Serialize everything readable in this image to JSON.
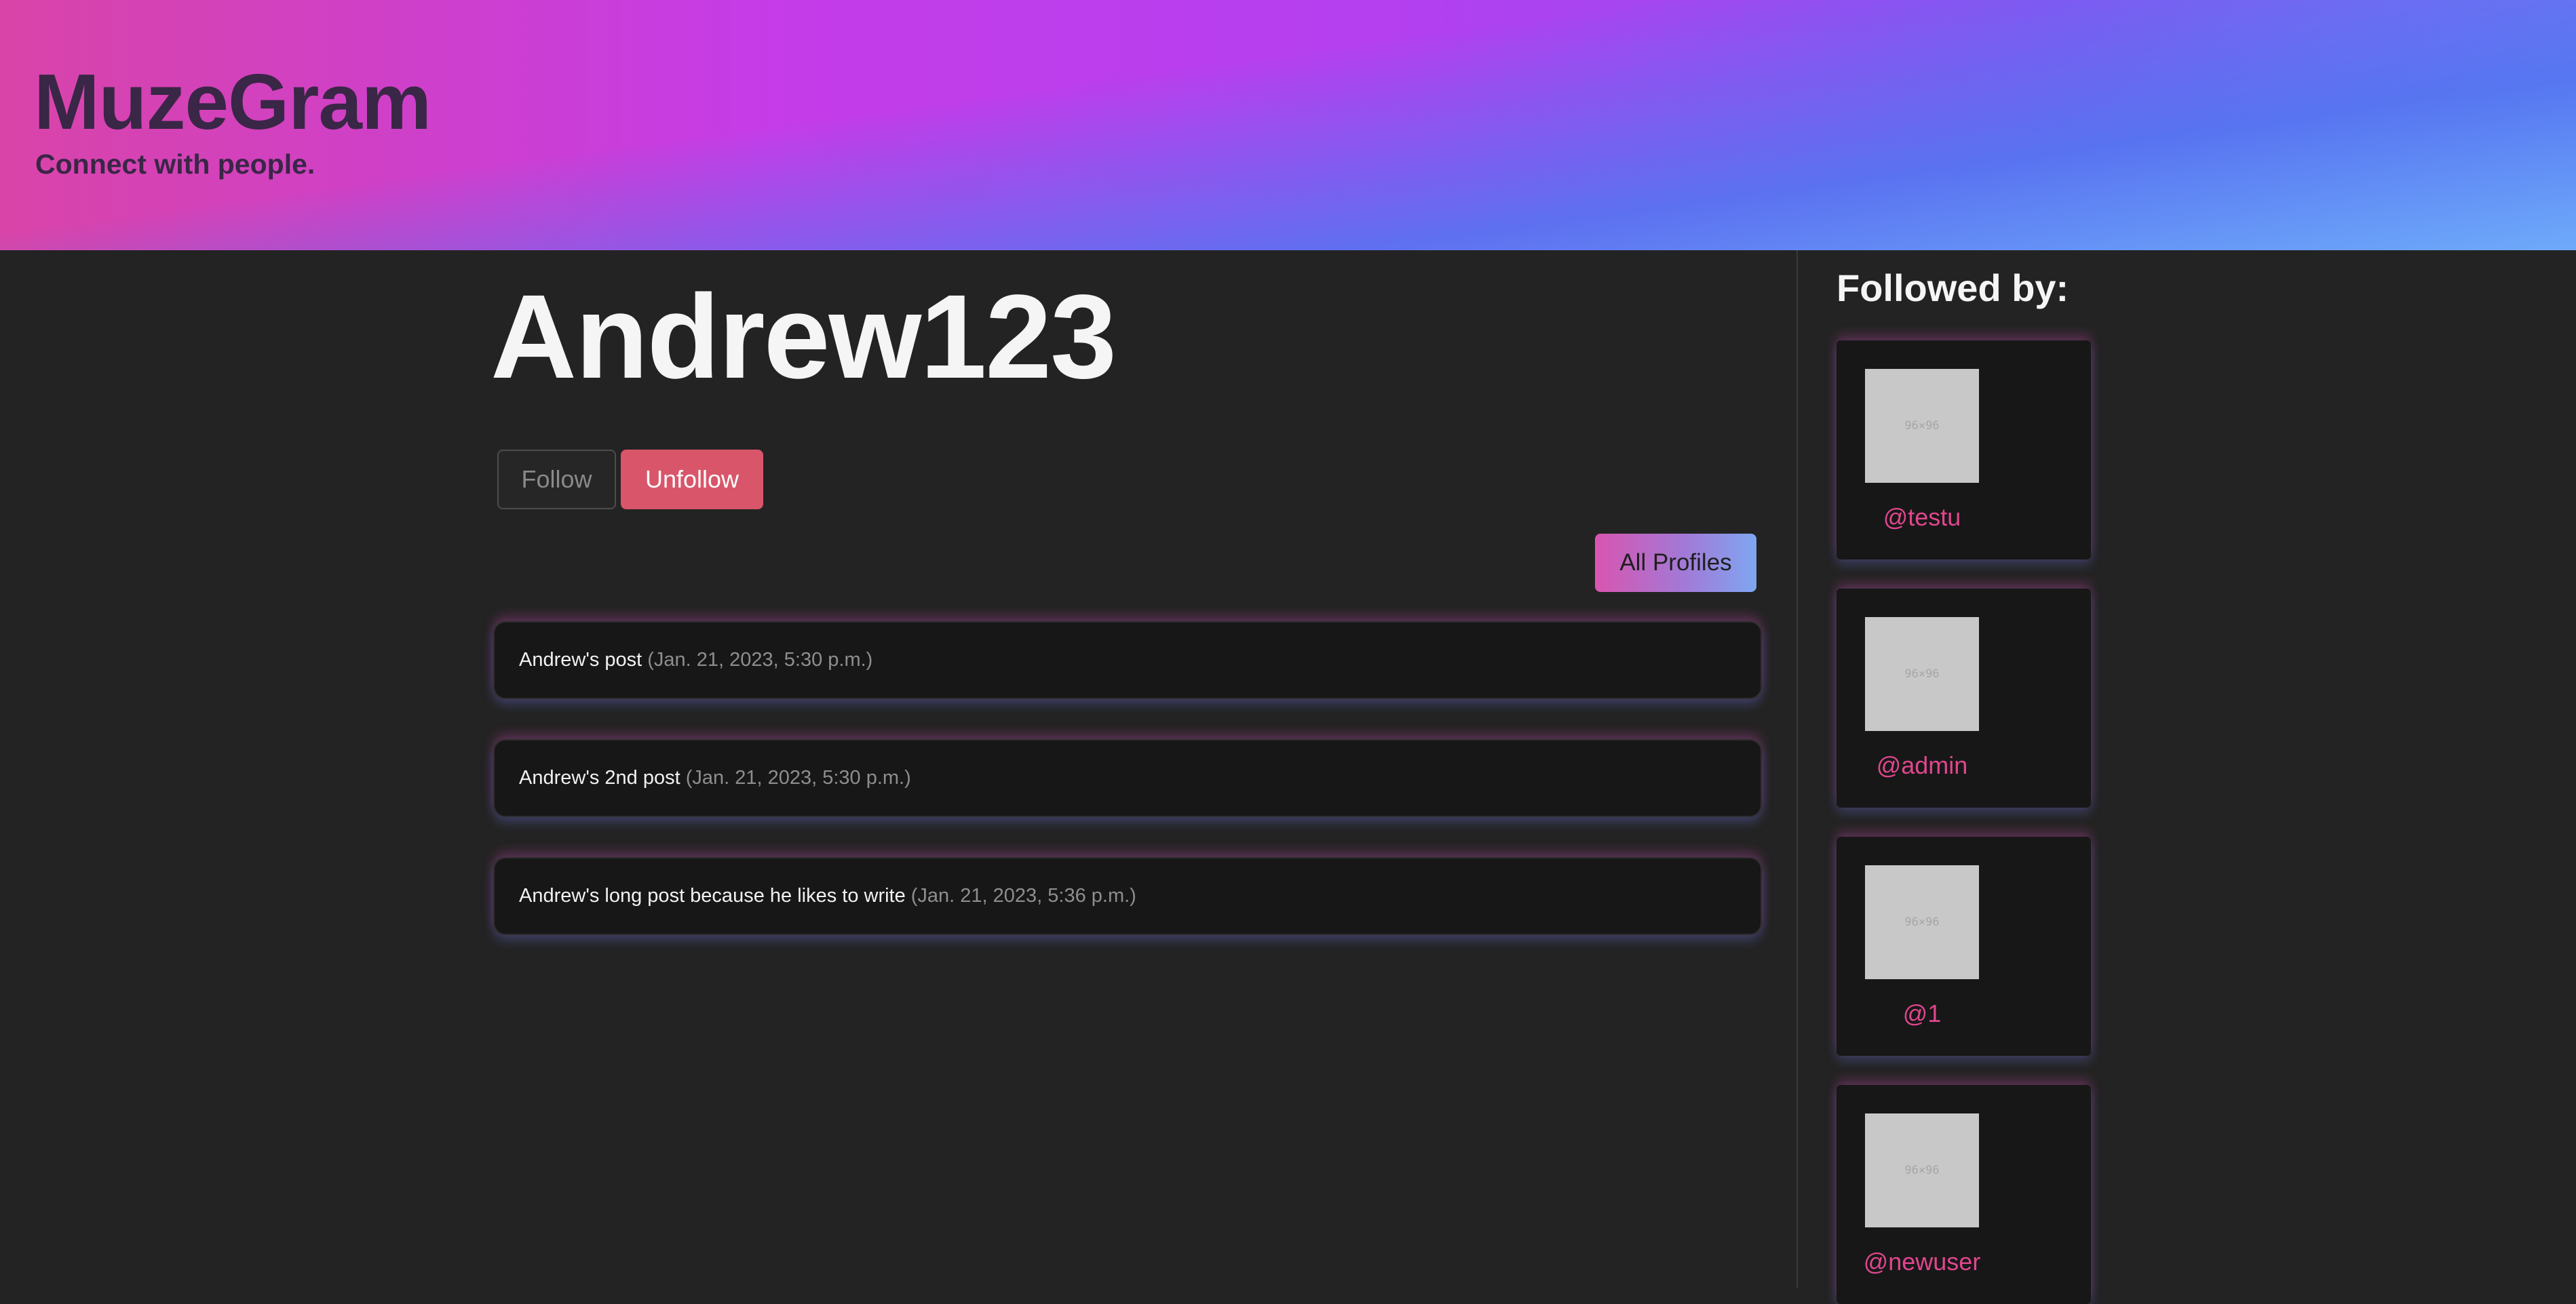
{
  "header": {
    "title": "MuzeGram",
    "tagline": "Connect with people."
  },
  "profile": {
    "username": "Andrew123",
    "follow_label": "Follow",
    "unfollow_label": "Unfollow",
    "all_profiles_label": "All Profiles"
  },
  "posts": [
    {
      "text": "Andrew's post",
      "date": "(Jan. 21, 2023, 5:30 p.m.)"
    },
    {
      "text": "Andrew's 2nd post",
      "date": "(Jan. 21, 2023, 5:30 p.m.)"
    },
    {
      "text": "Andrew's long post because he likes to write",
      "date": "(Jan. 21, 2023, 5:36 p.m.)"
    }
  ],
  "sidebar": {
    "title": "Followed by:",
    "followers": [
      {
        "handle": "@testu",
        "avatar_label": "96×96"
      },
      {
        "handle": "@admin",
        "avatar_label": "96×96"
      },
      {
        "handle": "@1",
        "avatar_label": "96×96"
      },
      {
        "handle": "@newuser",
        "avatar_label": "96×96"
      }
    ]
  },
  "colors": {
    "background": "#232323",
    "card": "#171717",
    "accent_pink": "#e0468e",
    "unfollow_red": "#d9566a",
    "brand_text": "#3a2646"
  }
}
